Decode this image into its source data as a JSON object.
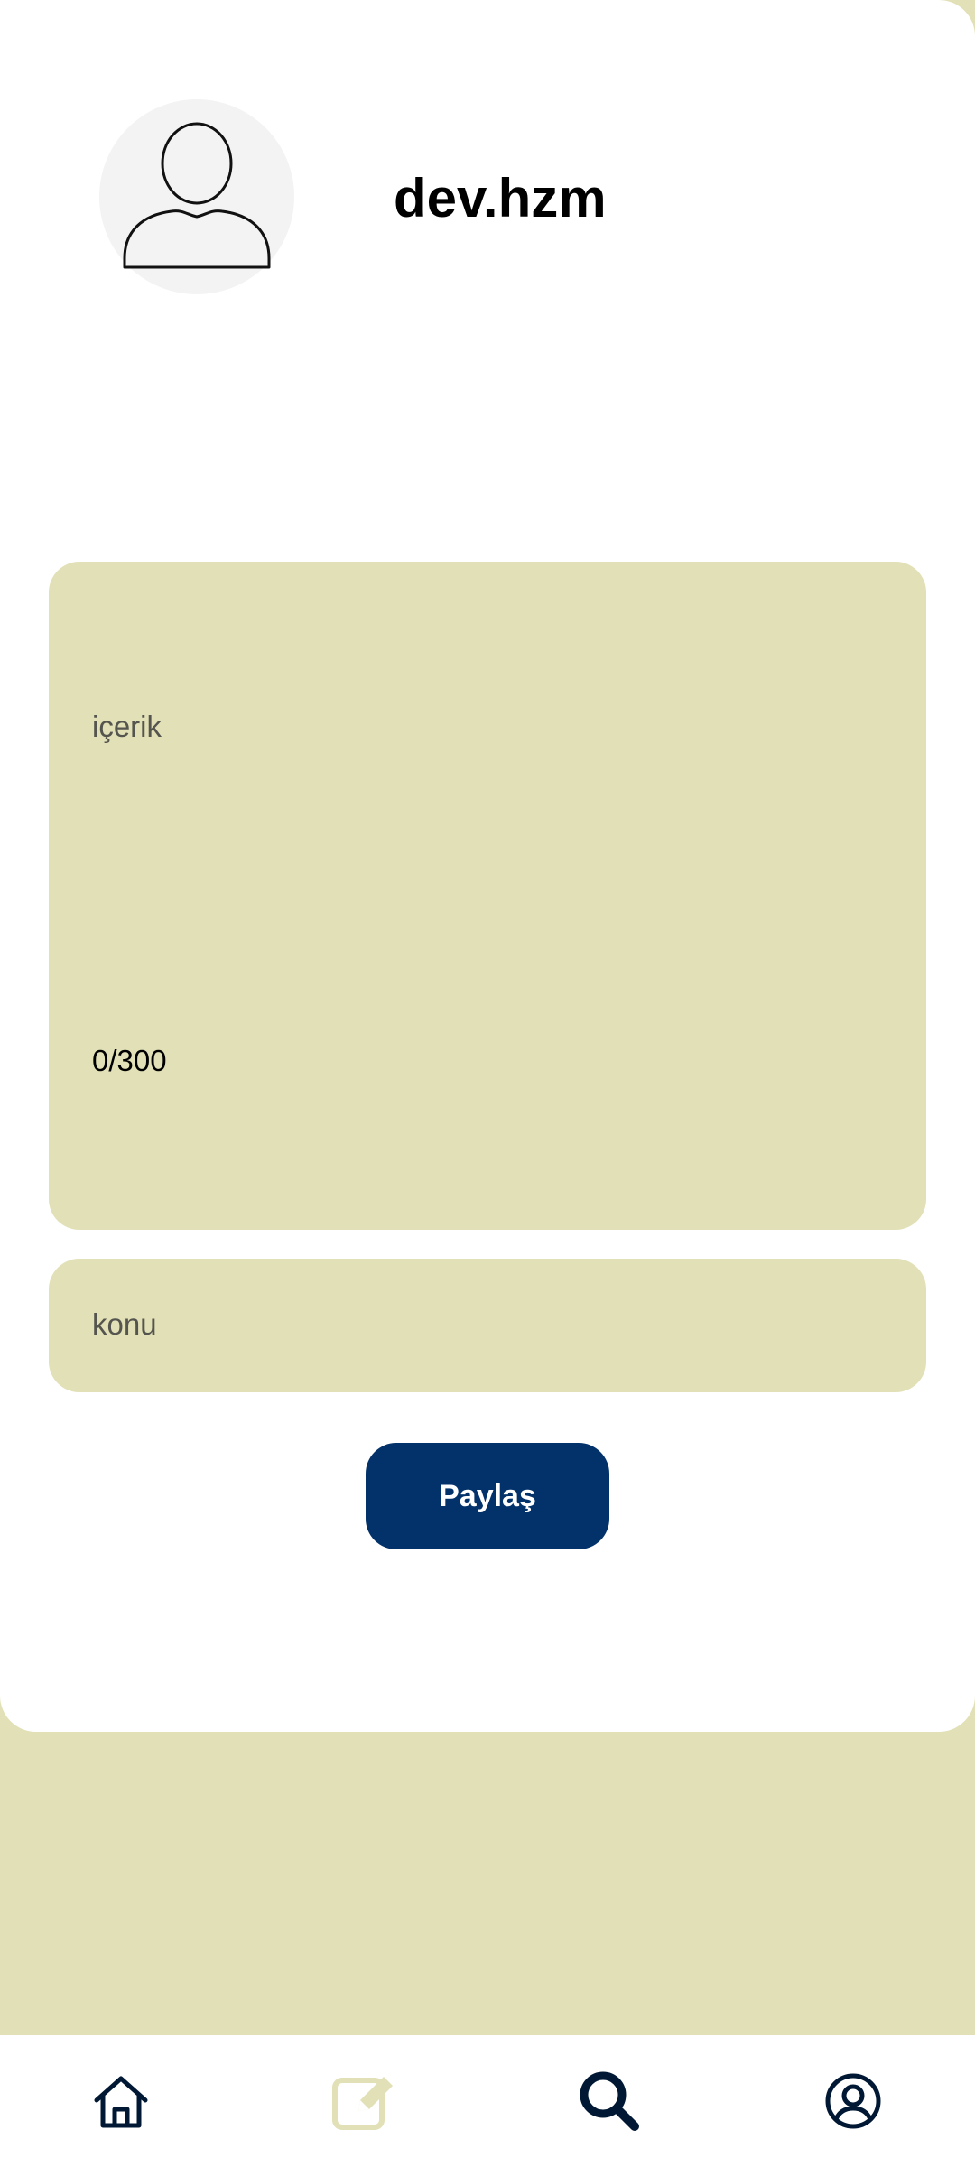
{
  "profile": {
    "username": "dev.hzm",
    "avatar_icon": "user-placeholder-icon"
  },
  "post_form": {
    "content_placeholder": "içerik",
    "char_counter": "0/300",
    "topic_placeholder": "konu",
    "share_label": "Paylaş"
  },
  "bottom_nav": {
    "items": [
      {
        "icon": "home-icon",
        "active": false
      },
      {
        "icon": "edit-icon",
        "active": true
      },
      {
        "icon": "search-icon",
        "active": false
      },
      {
        "icon": "profile-icon",
        "active": false
      }
    ]
  },
  "colors": {
    "background": "#e2e0b6",
    "card": "#ffffff",
    "field": "#e2e0b6",
    "button": "#03326b",
    "nav_icon": "#001833",
    "nav_icon_active": "#e2e0b6"
  }
}
